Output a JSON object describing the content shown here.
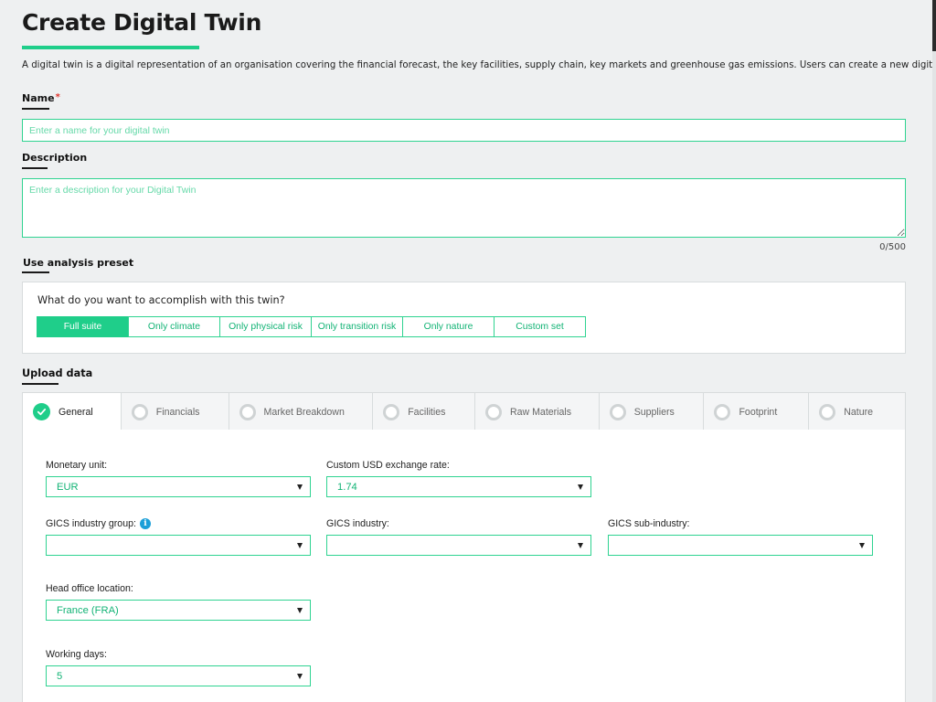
{
  "page": {
    "title": "Create Digital Twin",
    "intro": "A digital twin is a digital representation of an organisation covering the financial forecast, the key facilities, supply chain, key markets and greenhouse gas emissions. Users can create a new digital twin."
  },
  "name_field": {
    "label": "Name",
    "required_marker": "*",
    "placeholder": "Enter a name for your digital twin",
    "value": ""
  },
  "description_field": {
    "label": "Description",
    "placeholder": "Enter a description for your Digital Twin",
    "value": "",
    "counter": "0/500"
  },
  "preset": {
    "label": "Use analysis preset",
    "question": "What do you want to accomplish with this twin?",
    "options": [
      {
        "label": "Full suite",
        "active": true
      },
      {
        "label": "Only climate",
        "active": false
      },
      {
        "label": "Only physical risk",
        "active": false
      },
      {
        "label": "Only transition risk",
        "active": false
      },
      {
        "label": "Only nature",
        "active": false
      },
      {
        "label": "Custom set",
        "active": false
      }
    ]
  },
  "upload": {
    "label": "Upload data",
    "tabs": [
      {
        "label": "General",
        "active": true,
        "icon": "check-icon"
      },
      {
        "label": "Financials",
        "active": false,
        "icon": "radio-icon"
      },
      {
        "label": "Market Breakdown",
        "active": false,
        "icon": "radio-icon"
      },
      {
        "label": "Facilities",
        "active": false,
        "icon": "radio-icon"
      },
      {
        "label": "Raw Materials",
        "active": false,
        "icon": "radio-icon"
      },
      {
        "label": "Suppliers",
        "active": false,
        "icon": "radio-icon"
      },
      {
        "label": "Footprint",
        "active": false,
        "icon": "radio-icon"
      },
      {
        "label": "Nature",
        "active": false,
        "icon": "radio-icon"
      }
    ]
  },
  "general": {
    "monetary_unit": {
      "label": "Monetary unit:",
      "value": "EUR"
    },
    "exchange_rate": {
      "label": "Custom USD exchange rate:",
      "value": "1.74"
    },
    "gics_group": {
      "label": "GICS industry group:",
      "value": "",
      "info_icon": "i"
    },
    "gics_industry": {
      "label": "GICS industry:",
      "value": ""
    },
    "gics_sub": {
      "label": "GICS sub-industry:",
      "value": ""
    },
    "head_office": {
      "label": "Head office location:",
      "value": "France (FRA)"
    },
    "working_days": {
      "label": "Working days:",
      "value": "5"
    }
  },
  "colors": {
    "accent": "#1fce8a",
    "required": "#e0342d",
    "info": "#1c9fd8",
    "background": "#eef0f1"
  }
}
